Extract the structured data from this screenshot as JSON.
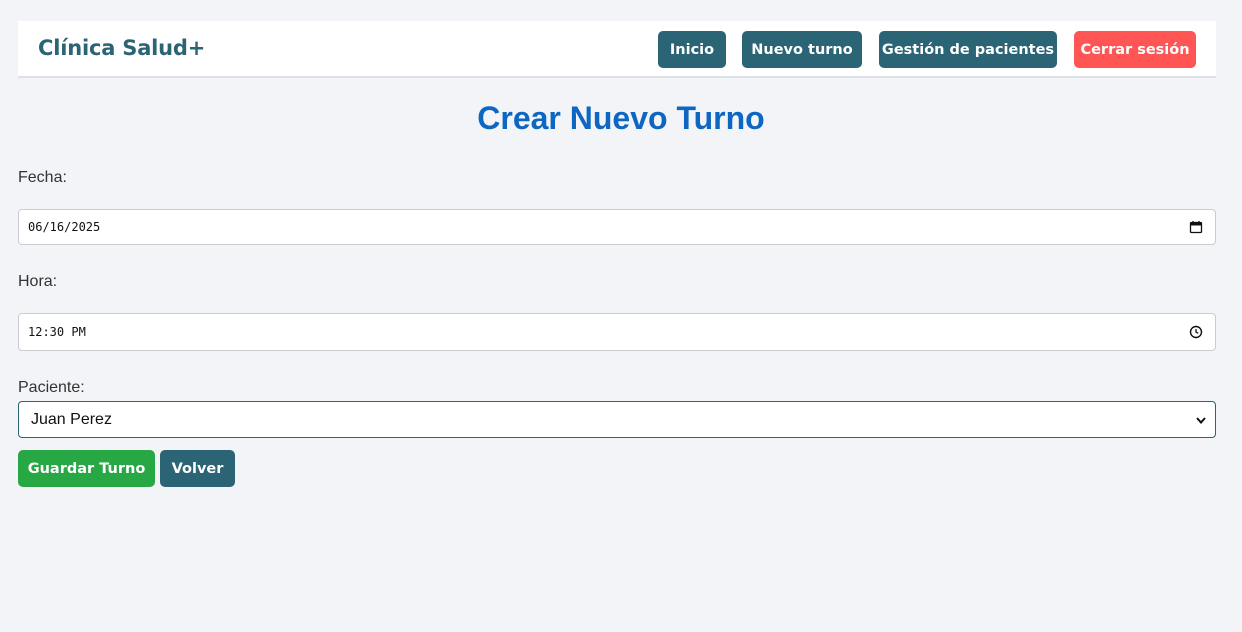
{
  "navbar": {
    "brand": "Clínica Salud+",
    "links": {
      "inicio": "Inicio",
      "nuevo_turno": "Nuevo turno",
      "gestion_pacientes": "Gestión de pacientes",
      "cerrar_sesion": "Cerrar sesión"
    }
  },
  "form": {
    "title": "Crear Nuevo Turno",
    "fecha_label": "Fecha:",
    "fecha_value": "06/16/2025",
    "hora_label": "Hora:",
    "hora_value": "12:30 PM",
    "paciente_label": "Paciente:",
    "paciente_value": "Juan Perez",
    "save_label": "Guardar Turno",
    "back_label": "Volver"
  },
  "colors": {
    "primary": "#2b6474",
    "danger": "#ff5555",
    "success": "#28a745",
    "title": "#0d66c2"
  },
  "icons": {
    "date": "calendar-icon",
    "time": "clock-icon",
    "select": "chevron-down-icon"
  }
}
